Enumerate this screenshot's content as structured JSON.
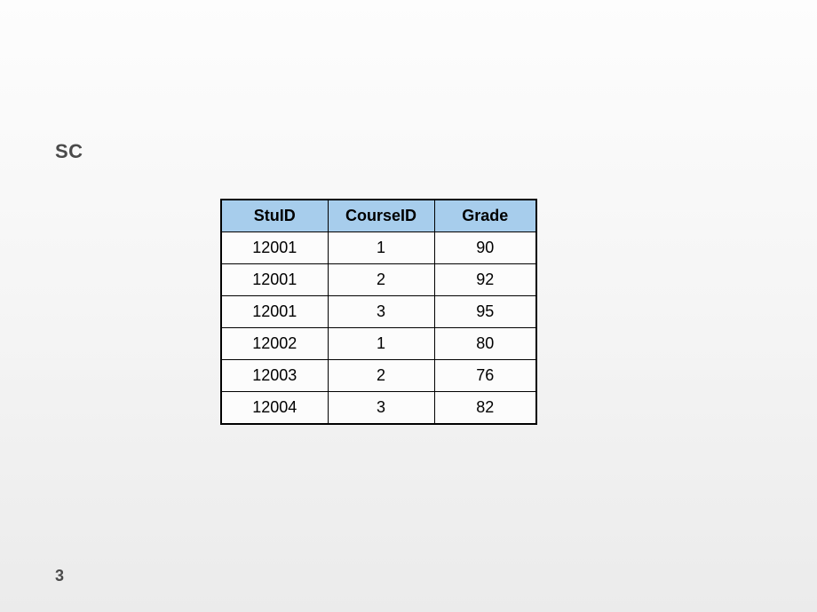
{
  "title": "SC",
  "page_number": "3",
  "table": {
    "headers": [
      "StuID",
      "CourseID",
      "Grade"
    ],
    "rows": [
      [
        "12001",
        "1",
        "90"
      ],
      [
        "12001",
        "2",
        "92"
      ],
      [
        "12001",
        "3",
        "95"
      ],
      [
        "12002",
        "1",
        "80"
      ],
      [
        "12003",
        "2",
        "76"
      ],
      [
        "12004",
        "3",
        "82"
      ]
    ]
  },
  "chart_data": {
    "type": "table",
    "title": "SC",
    "columns": [
      "StuID",
      "CourseID",
      "Grade"
    ],
    "rows": [
      {
        "StuID": 12001,
        "CourseID": 1,
        "Grade": 90
      },
      {
        "StuID": 12001,
        "CourseID": 2,
        "Grade": 92
      },
      {
        "StuID": 12001,
        "CourseID": 3,
        "Grade": 95
      },
      {
        "StuID": 12002,
        "CourseID": 1,
        "Grade": 80
      },
      {
        "StuID": 12003,
        "CourseID": 2,
        "Grade": 76
      },
      {
        "StuID": 12004,
        "CourseID": 3,
        "Grade": 82
      }
    ]
  }
}
